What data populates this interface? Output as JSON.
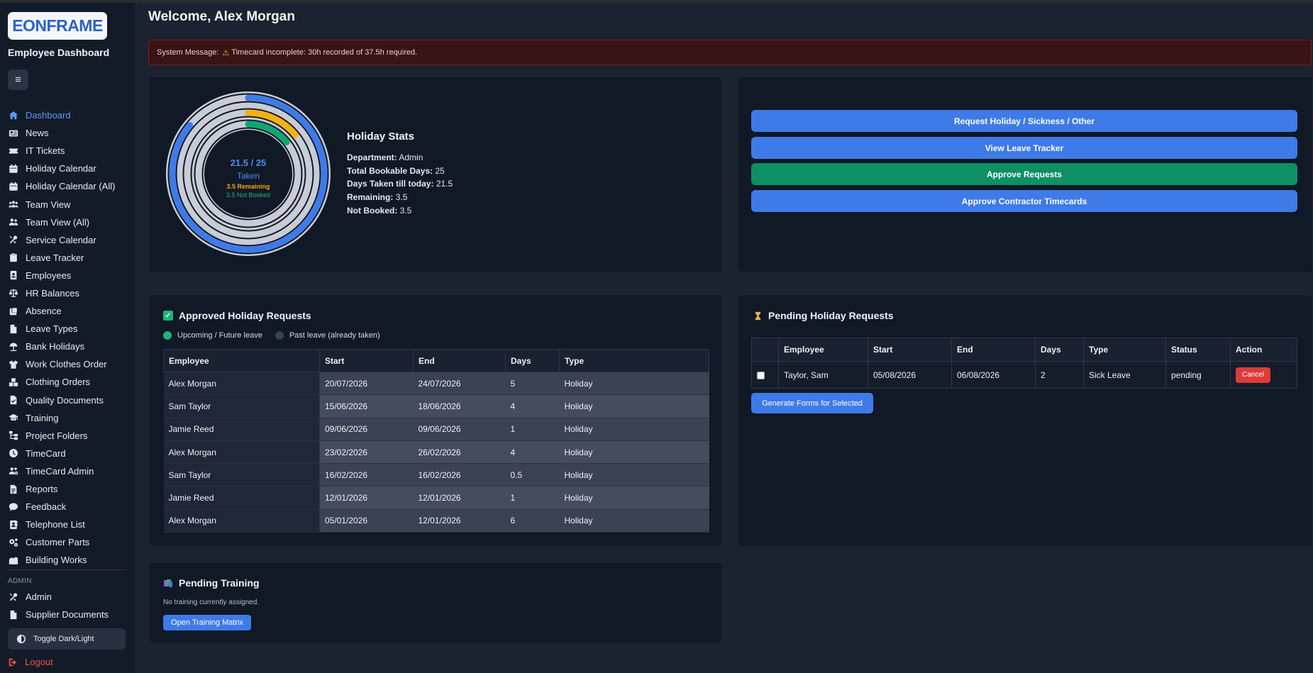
{
  "brand": {
    "logo": "EONFRAME",
    "subtitle": "Employee Dashboard",
    "menu_icon": "≡"
  },
  "nav": [
    {
      "label": "Dashboard",
      "icon": "home-icon",
      "active": true
    },
    {
      "label": "News",
      "icon": "newspaper-icon"
    },
    {
      "label": "IT Tickets",
      "icon": "ticket-icon"
    },
    {
      "label": "Holiday Calendar",
      "icon": "calendar-icon"
    },
    {
      "label": "Holiday Calendar (All)",
      "icon": "calendar-icon"
    },
    {
      "label": "Team View",
      "icon": "team-icon"
    },
    {
      "label": "Team View (All)",
      "icon": "users-icon"
    },
    {
      "label": "Service Calendar",
      "icon": "tools-icon"
    },
    {
      "label": "Leave Tracker",
      "icon": "clipboard-icon"
    },
    {
      "label": "Employees",
      "icon": "id-badge-icon"
    },
    {
      "label": "HR Balances",
      "icon": "scale-icon"
    },
    {
      "label": "Absence",
      "icon": "absence-icon"
    },
    {
      "label": "Leave Types",
      "icon": "file-icon"
    },
    {
      "label": "Bank Holidays",
      "icon": "beach-umbrella-icon"
    },
    {
      "label": "Work Clothes Order",
      "icon": "shirt-icon"
    },
    {
      "label": "Clothing Orders",
      "icon": "boxes-icon"
    },
    {
      "label": "Quality Documents",
      "icon": "document-check-icon"
    },
    {
      "label": "Training",
      "icon": "graduation-cap-icon"
    },
    {
      "label": "Project Folders",
      "icon": "folder-tree-icon"
    },
    {
      "label": "TimeCard",
      "icon": "clock-icon"
    },
    {
      "label": "TimeCard Admin",
      "icon": "users-cog-icon"
    },
    {
      "label": "Reports",
      "icon": "report-icon"
    },
    {
      "label": "Feedback",
      "icon": "comment-icon"
    },
    {
      "label": "Telephone List",
      "icon": "address-book-icon"
    },
    {
      "label": "Customer Parts",
      "icon": "cogs-icon"
    },
    {
      "label": "Building Works",
      "icon": "building-icon"
    }
  ],
  "admin_section": {
    "label": "ADMIN",
    "items": [
      {
        "label": "Admin",
        "icon": "tools-icon"
      },
      {
        "label": "Supplier Documents",
        "icon": "file-icon"
      }
    ]
  },
  "toggle_label": "Toggle Dark/Light",
  "logout_label": "Logout",
  "welcome": "Welcome, Alex Morgan",
  "alert": {
    "prefix": "System Message:",
    "icon": "⚠",
    "text": "Timecard incomplete: 30h recorded of 37.5h required."
  },
  "holiday_ring": {
    "total_label": "21.5 / 25",
    "taken_label": "Taken",
    "remaining_label": "3.5 Remaining",
    "not_booked_label": "3.5 Not Booked",
    "taken_fraction": 0.86,
    "remaining_fraction": 0.14,
    "not_booked_fraction": 0.14,
    "colors": {
      "taken": "#3e7be8",
      "remaining": "#f2b10f",
      "not_booked": "#11a56f",
      "track": "#c7ccd6"
    }
  },
  "holiday_stats": {
    "title": "Holiday Stats",
    "lines": [
      {
        "k": "Department:",
        "v": "Admin"
      },
      {
        "k": "Total Bookable Days:",
        "v": "25"
      },
      {
        "k": "Days Taken till today:",
        "v": "21.5"
      },
      {
        "k": "Remaining:",
        "v": "3.5"
      },
      {
        "k": "Not Booked:",
        "v": "3.5"
      }
    ]
  },
  "actions": [
    {
      "label": "Request Holiday / Sickness / Other",
      "color": "blue"
    },
    {
      "label": "View Leave Tracker",
      "color": "blue"
    },
    {
      "label": "Approve Requests",
      "color": "green"
    },
    {
      "label": "Approve Contractor Timecards",
      "color": "blue"
    }
  ],
  "approved": {
    "title": "Approved Holiday Requests",
    "icon": "✅",
    "legend_upcoming": "Upcoming / Future leave",
    "legend_past": "Past leave (already taken)",
    "columns": [
      "Employee",
      "Start",
      "End",
      "Days",
      "Type"
    ],
    "rows": [
      [
        "Alex Morgan",
        "20/07/2026",
        "24/07/2026",
        "5",
        "Holiday"
      ],
      [
        "Sam Taylor",
        "15/06/2026",
        "18/06/2026",
        "4",
        "Holiday"
      ],
      [
        "Jamie Reed",
        "09/06/2026",
        "09/06/2026",
        "1",
        "Holiday"
      ],
      [
        "Alex Morgan",
        "23/02/2026",
        "26/02/2026",
        "4",
        "Holiday"
      ],
      [
        "Sam Taylor",
        "16/02/2026",
        "16/02/2026",
        "0.5",
        "Holiday"
      ],
      [
        "Jamie Reed",
        "12/01/2026",
        "12/01/2026",
        "1",
        "Holiday"
      ],
      [
        "Alex Morgan",
        "05/01/2026",
        "12/01/2026",
        "6",
        "Holiday"
      ]
    ]
  },
  "pending": {
    "title": "Pending Holiday Requests",
    "icon": "⏳",
    "columns": [
      "",
      "Employee",
      "Start",
      "End",
      "Days",
      "Type",
      "Status",
      "Action"
    ],
    "rows": [
      {
        "employee": "Taylor, Sam",
        "start": "05/08/2026",
        "end": "06/08/2026",
        "days": "2",
        "type": "Sick Leave",
        "status": "pending",
        "action": "Cancel"
      }
    ],
    "generate_label": "Generate Forms for Selected"
  },
  "training": {
    "title": "Pending Training",
    "empty_text": "No training currently assigned.",
    "button_label": "Open Training Matrix"
  }
}
